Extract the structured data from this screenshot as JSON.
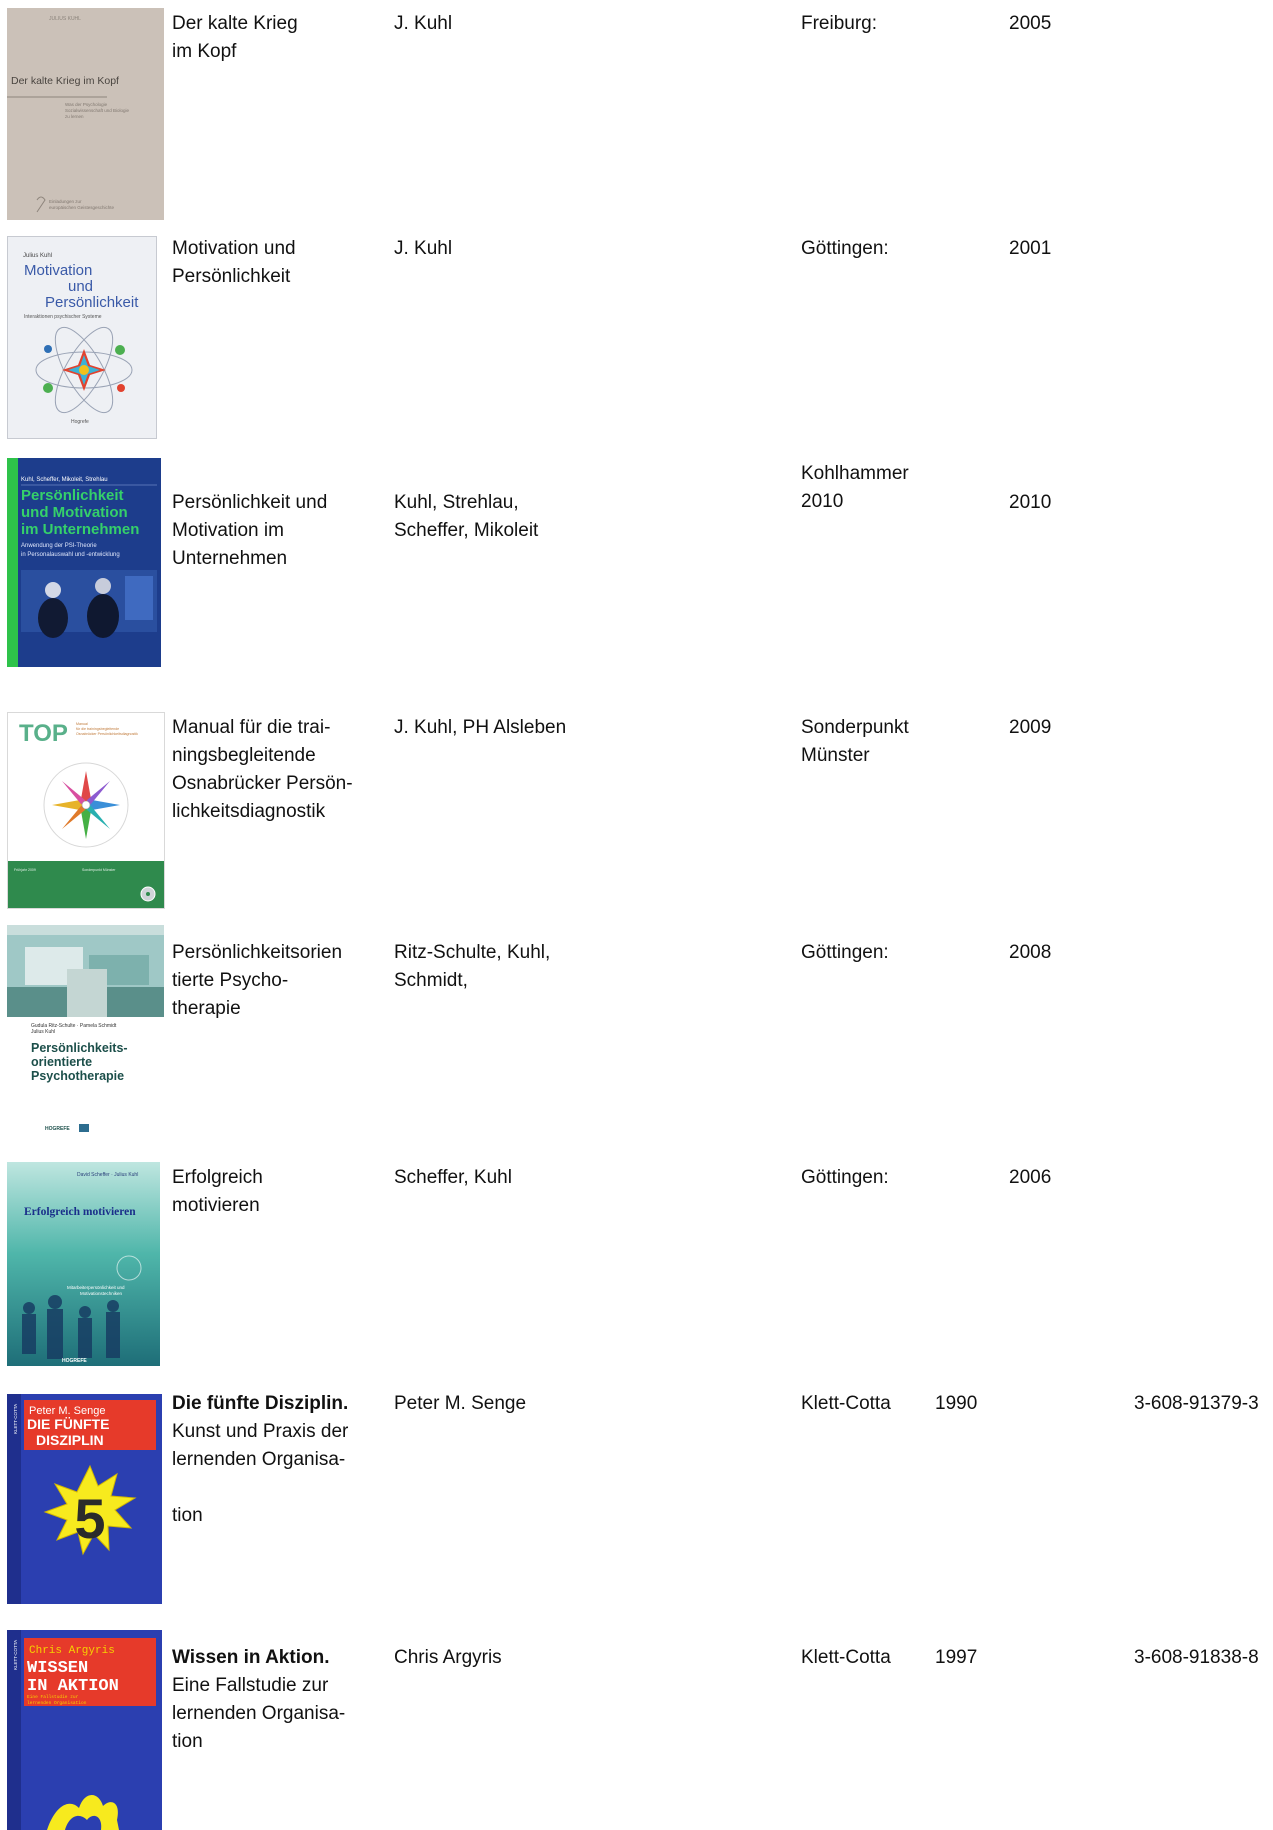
{
  "books": [
    {
      "title_lines": [
        "Der kalte Krieg",
        "im Kopf"
      ],
      "authors_lines": [
        "J. Kuhl"
      ],
      "publisher_lines": [
        "Freiburg:"
      ],
      "year": "2005",
      "cover": {
        "header": "JULIUS KUHL",
        "title": "Der kalte Krieg im Kopf",
        "subtitle": "Was der Psychologie Sozialwissenschaft und Biologie zu lernen",
        "series": "Einladungen zur europäischen Geistesgeschichte",
        "bg": "#cbc1b8"
      }
    },
    {
      "title_lines": [
        "Motivation und",
        "Persönlichkeit"
      ],
      "authors_lines": [
        "J. Kuhl"
      ],
      "publisher_lines": [
        "Göttingen:"
      ],
      "year": "2001",
      "cover": {
        "header": "Julius Kuhl",
        "title_1": "Motivation",
        "title_2": "und",
        "title_3": "Persönlichkeit",
        "subtitle": "Interaktionen psychischer Systeme",
        "publisher": "Hogrefe",
        "bg": "#eef0f4"
      }
    },
    {
      "title_lines": [
        "Persönlichkeit und",
        "Motivation im",
        "Unternehmen"
      ],
      "authors_lines": [
        "Kuhl, Strehlau,",
        "Scheffer, Mikoleit"
      ],
      "publisher_lines": [
        "Kohlhammer",
        "2010"
      ],
      "year": "2010",
      "cover": {
        "header": "Kuhl, Scheffer, Mikoleit, Strehlau",
        "title_1": "Persönlichkeit",
        "title_2": "und Motivation",
        "title_3": "im Unternehmen",
        "subtitle_1": "Anwendung der PSI-Theorie",
        "subtitle_2": "in Personalauswahl und -entwicklung",
        "publisher": "Kohlhammer",
        "bg": "#1d3d8c",
        "accent": "#2ec24a"
      }
    },
    {
      "title_lines": [
        "Manual für die trai-",
        "ningsbegleitende",
        "Osnabrücker Persön-",
        "lichkeitsdiagnostik"
      ],
      "authors_lines": [
        "J. Kuhl, PH Alsleben"
      ],
      "publisher_lines": [
        "Sonderpunkt",
        "Münster"
      ],
      "year": "2009",
      "cover": {
        "header": "TOP",
        "note": "Manual für die trainingsbegleitende Osnabrücker Persönlichkeitsdiagnostik",
        "bg": "#ffffff",
        "band": "#2f8a4d"
      }
    },
    {
      "title_lines": [
        "Persönlichkeitsorien",
        "tierte Psycho-",
        "therapie"
      ],
      "authors_lines": [
        "Ritz-Schulte, Kuhl,",
        "Schmidt,"
      ],
      "publisher_lines": [
        "Göttingen:"
      ],
      "year": "2008",
      "cover": {
        "authors": "Gudula Ritz-Schulte · Pamela Schmidt",
        "authors_2": "Julius Kuhl",
        "title_1": "Persönlichkeits-",
        "title_2": "orientierte",
        "title_3": "Psychotherapie",
        "publisher": "HOGREFE",
        "bg": "#ffffff",
        "accent": "#1c4f4a"
      }
    },
    {
      "title_lines": [
        "Erfolgreich",
        "motivieren"
      ],
      "authors_lines": [
        "Scheffer, Kuhl"
      ],
      "publisher_lines": [
        "Göttingen:"
      ],
      "year": "2006",
      "cover": {
        "authors": "David Scheffer · Julius Kuhl",
        "title": "Erfolgreich motivieren",
        "subtitle": "Mitarbeiterpersönlichkeit und Motivationstechniken",
        "publisher": "HOGREFE",
        "bg": "#3aa79c"
      }
    },
    {
      "title_bold": "Die fünfte Disziplin.",
      "title_lines": [
        "Kunst und Praxis der",
        "lernenden Organisa-",
        "",
        "tion"
      ],
      "authors_lines": [
        "Peter M. Senge"
      ],
      "publisher_lines": [
        "Klett-Cotta"
      ],
      "year": "1990",
      "isbn": "3-608-91379-3",
      "cover": {
        "header": "Peter M. Senge",
        "title_1": "DIE FÜNFTE",
        "title_2": "DISZIPLIN",
        "number": "5",
        "spine": "KLETT-COTTA",
        "bg": "#2b3fb0"
      }
    },
    {
      "title_bold": "Wissen in Aktion.",
      "title_lines": [
        "Eine Fallstudie zur",
        "lernenden Organisa-",
        "tion"
      ],
      "authors_lines": [
        "Chris Argyris"
      ],
      "publisher_lines": [
        "Klett-Cotta"
      ],
      "year": "1997",
      "isbn": "3-608-91838-8",
      "cover": {
        "header": "Chris Argyris",
        "title_1": "WISSEN",
        "title_2": "IN AKTION",
        "subtitle": "Eine Fallstudie zur lernenden Organisation",
        "spine": "KLETT-COTTA",
        "bg": "#2b3fb0"
      }
    }
  ]
}
